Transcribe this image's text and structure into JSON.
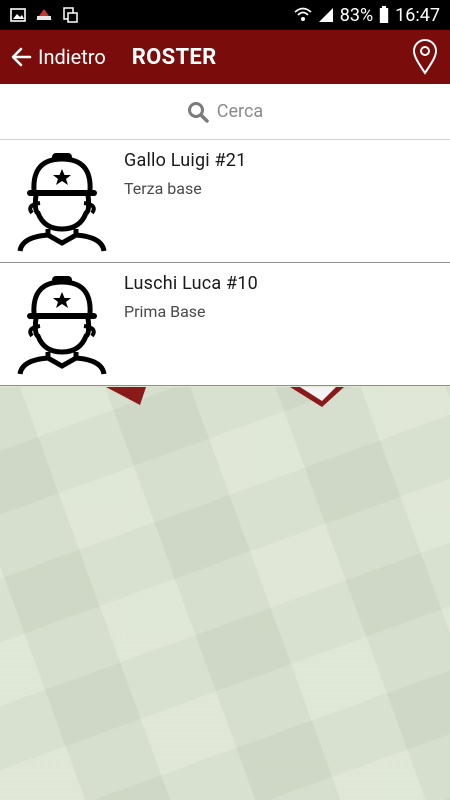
{
  "statusbar": {
    "battery": "83%",
    "time": "16:47"
  },
  "header": {
    "back_label": "Indietro",
    "title": "ROSTER"
  },
  "search": {
    "placeholder": "Cerca"
  },
  "players": [
    {
      "name": "Gallo Luigi #21",
      "role": "Terza base"
    },
    {
      "name": "Luschi Luca #10",
      "role": "Prima Base"
    }
  ],
  "colors": {
    "header_bg": "#7a0c0c",
    "statusbar_bg": "#000000"
  }
}
